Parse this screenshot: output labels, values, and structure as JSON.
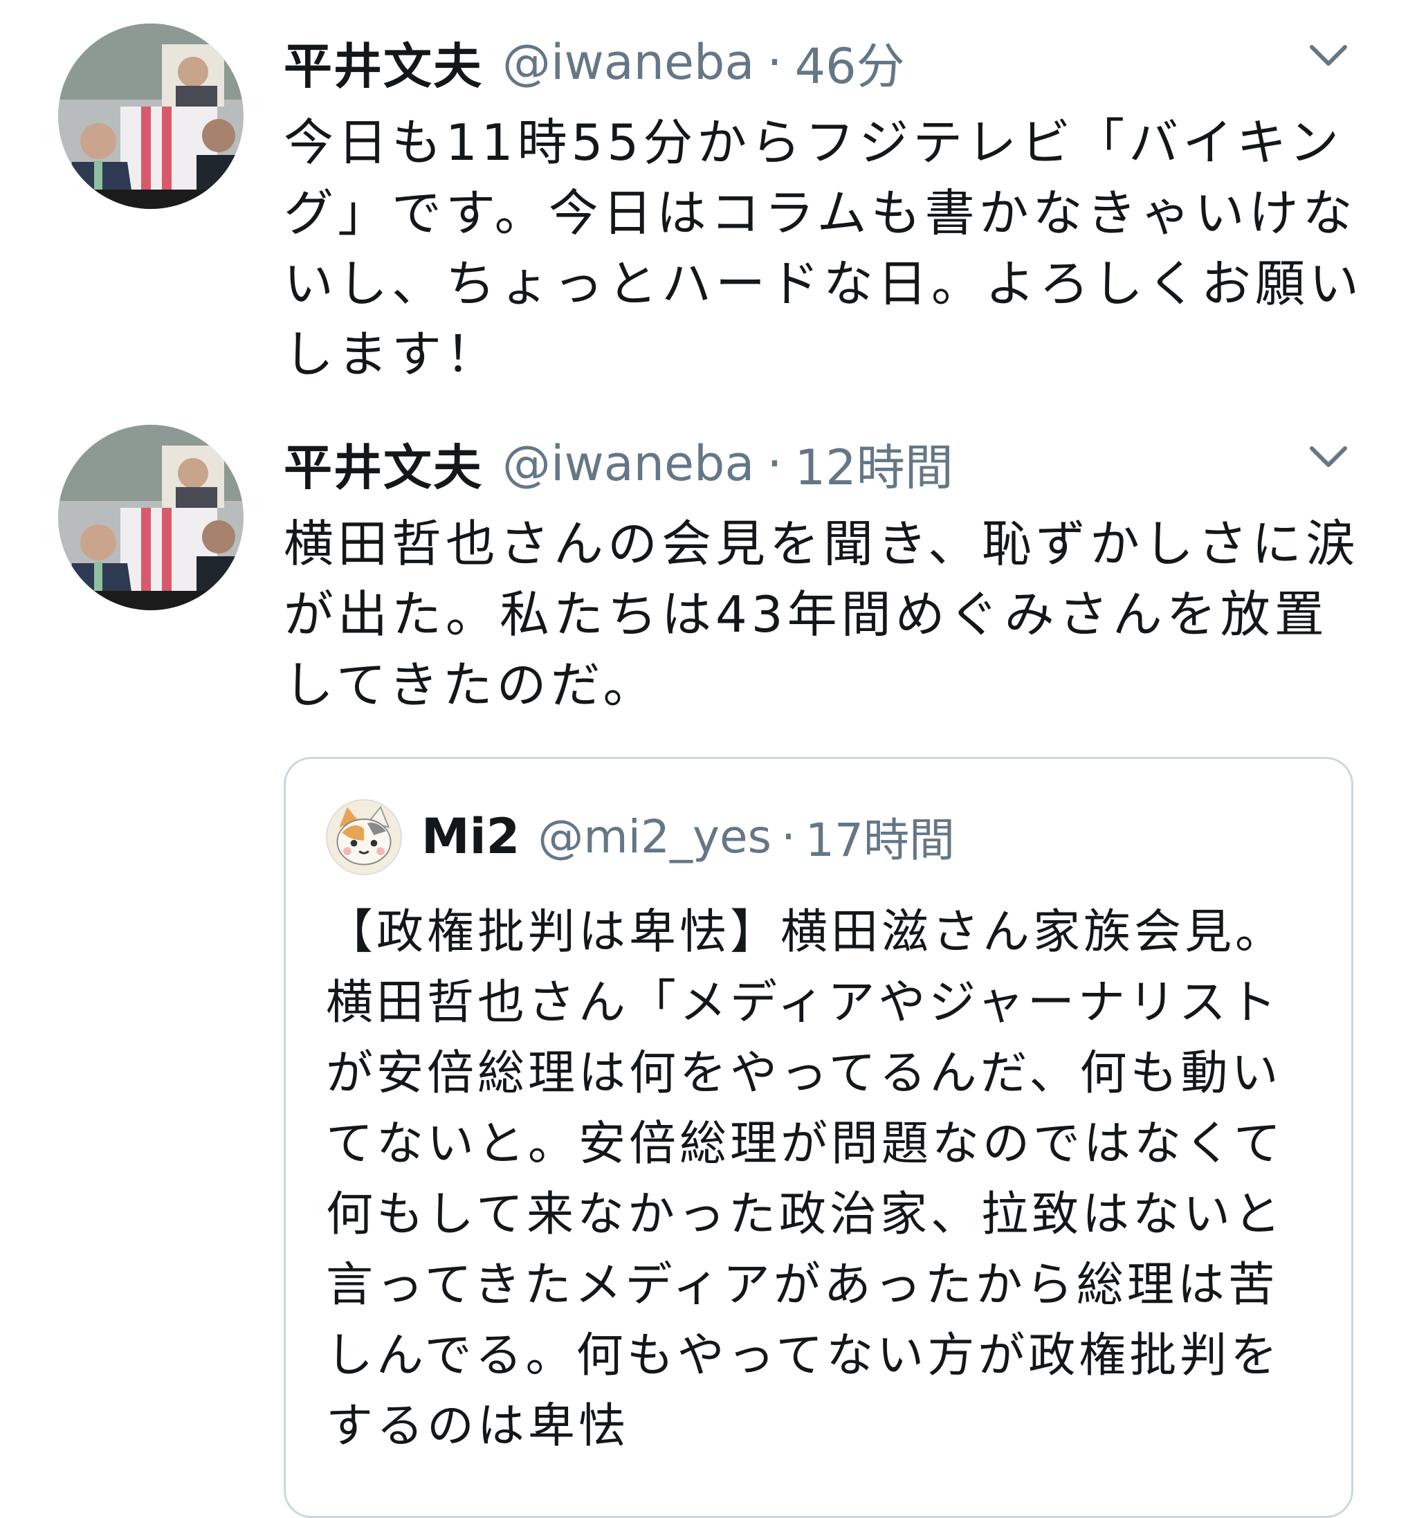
{
  "tweets": [
    {
      "author_name": "平井文夫",
      "author_handle": "@iwaneba",
      "separator": "·",
      "time": "46分",
      "text": "今日も11時55分からフジテレビ「バイキング」です。今日はコラムも書かなきゃいけないし、ちょっとハードな日。よろしくお願いします！",
      "avatar": "profile-photo-icon",
      "menu_icon": "chevron-down-icon"
    },
    {
      "author_name": "平井文夫",
      "author_handle": "@iwaneba",
      "separator": "·",
      "time": "12時間",
      "text": "横田哲也さんの会見を聞き、恥ずかしさに涙が出た。私たちは43年間めぐみさんを放置してきたのだ。",
      "avatar": "profile-photo-icon",
      "menu_icon": "chevron-down-icon",
      "quoted_tweet": {
        "author_name": "Mi2",
        "author_handle": "@mi2_yes",
        "separator": "·",
        "time": "17時間",
        "text": "【政権批判は卑怯】横田滋さん家族会見。横田哲也さん「メディアやジャーナリストが安倍総理は何をやってるんだ、何も動いてないと。安倍総理が問題なのではなくて何もして来なかった政治家、拉致はないと言ってきたメディアがあったから総理は苦しんでる。何もやってない方が政権批判をするのは卑怯",
        "avatar": "cat-avatar-icon"
      }
    }
  ],
  "colors": {
    "text_primary": "#14171a",
    "text_secondary": "#657786",
    "border": "#ccd6dd",
    "background": "#ffffff"
  }
}
